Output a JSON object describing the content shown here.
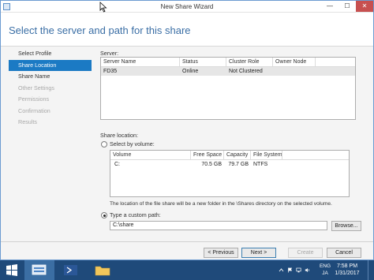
{
  "window": {
    "title": "New Share Wizard",
    "min_glyph": "—",
    "max_glyph": "☐",
    "close_glyph": "✕"
  },
  "page_title": "Select the server and path for this share",
  "nav": [
    {
      "label": "Select Profile",
      "state": "normal"
    },
    {
      "label": "Share Location",
      "state": "active"
    },
    {
      "label": "Share Name",
      "state": "normal"
    },
    {
      "label": "Other Settings",
      "state": "disabled"
    },
    {
      "label": "Permissions",
      "state": "disabled"
    },
    {
      "label": "Confirmation",
      "state": "disabled"
    },
    {
      "label": "Results",
      "state": "disabled"
    }
  ],
  "server": {
    "label": "Server:",
    "columns": [
      "Server Name",
      "Status",
      "Cluster Role",
      "Owner Node"
    ],
    "rows": [
      [
        "FD35",
        "Online",
        "Not Clustered",
        ""
      ]
    ]
  },
  "share_location": {
    "label": "Share location:",
    "by_volume_label": "Select by volume:",
    "by_volume_selected": false,
    "columns": [
      "Volume",
      "Free Space",
      "Capacity",
      "File System"
    ],
    "rows": [
      [
        "C:",
        "70.5 GB",
        "79.7 GB",
        "NTFS"
      ]
    ],
    "note": "The location of the file share will be a new folder in the \\Shares directory on the selected volume.",
    "custom_path_label": "Type a custom path:",
    "custom_path_selected": true,
    "custom_path_value": "C:\\share",
    "browse_label": "Browse..."
  },
  "footer": {
    "previous_label": "< Previous",
    "next_label": "Next >",
    "create_label": "Create",
    "cancel_label": "Cancel"
  },
  "taskbar": {
    "language": "ENG",
    "ime": "JA",
    "time": "7:58 PM",
    "date": "1/31/2017"
  },
  "colors": {
    "accent": "#1b7ac4",
    "title_blue": "#3a6ea5",
    "taskbar": "#1f4a7a",
    "close_red": "#c75050"
  }
}
